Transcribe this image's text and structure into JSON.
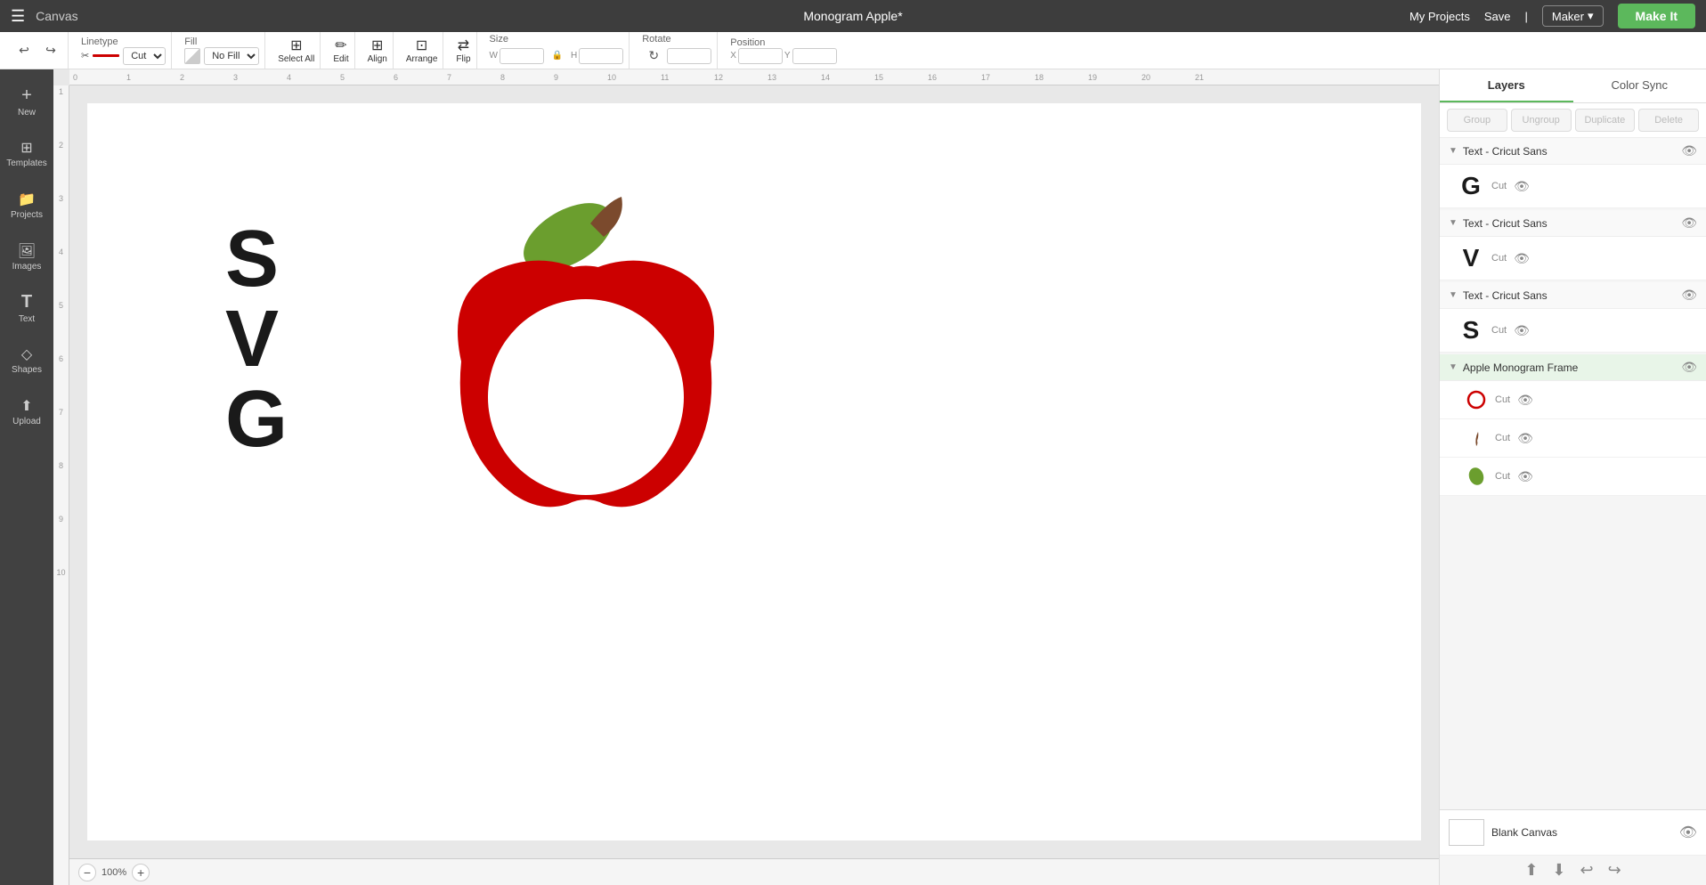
{
  "app": {
    "title": "Canvas",
    "project_title": "Monogram Apple*",
    "nav": {
      "my_projects": "My Projects",
      "save": "Save",
      "maker": "Maker",
      "make_it": "Make It"
    }
  },
  "toolbar": {
    "linetype_label": "Linetype",
    "linetype_value": "Cut",
    "fill_label": "Fill",
    "fill_value": "No Fill",
    "select_all": "Select All",
    "edit": "Edit",
    "align": "Align",
    "arrange": "Arrange",
    "flip": "Flip",
    "size": "Size",
    "rotate": "Rotate",
    "position": "Position",
    "undo_label": "undo",
    "redo_label": "redo"
  },
  "sidebar": {
    "items": [
      {
        "id": "new",
        "label": "New",
        "icon": "+"
      },
      {
        "id": "templates",
        "label": "Templates",
        "icon": "⊞"
      },
      {
        "id": "projects",
        "label": "Projects",
        "icon": "📁"
      },
      {
        "id": "images",
        "label": "Images",
        "icon": "🖼"
      },
      {
        "id": "text",
        "label": "Text",
        "icon": "T"
      },
      {
        "id": "shapes",
        "label": "Shapes",
        "icon": "◇"
      },
      {
        "id": "upload",
        "label": "Upload",
        "icon": "↑"
      }
    ]
  },
  "layers": {
    "tab_layers": "Layers",
    "tab_color_sync": "Color Sync",
    "actions": {
      "group": "Group",
      "ungroup": "Ungroup",
      "duplicate": "Duplicate",
      "delete": "Delete"
    },
    "items": [
      {
        "type": "group",
        "name": "Text - Cricut Sans",
        "children": [
          {
            "letter": "G",
            "sublabel": "Cut",
            "color": "#1a1a1a",
            "is_text": true
          }
        ]
      },
      {
        "type": "group",
        "name": "Text - Cricut Sans",
        "children": [
          {
            "letter": "V",
            "sublabel": "Cut",
            "color": "#1a1a1a",
            "is_text": true
          }
        ]
      },
      {
        "type": "group",
        "name": "Text - Cricut Sans",
        "children": [
          {
            "letter": "S",
            "sublabel": "Cut",
            "color": "#1a1a1a",
            "is_text": true
          }
        ]
      },
      {
        "type": "group",
        "name": "Apple Monogram Frame",
        "selected": true,
        "children": [
          {
            "sublabel": "Cut",
            "color": "#cc0000",
            "shape": "circle_outline"
          },
          {
            "sublabel": "Cut",
            "color": "#7b4a2d",
            "shape": "stem"
          },
          {
            "sublabel": "Cut",
            "color": "#6b9e2e",
            "shape": "leaf"
          }
        ]
      }
    ],
    "footer": {
      "blank_canvas": "Blank Canvas"
    }
  },
  "canvas": {
    "zoom": "100%",
    "letters": "S\nV\nG",
    "zoom_minus": "−",
    "zoom_plus": "+"
  }
}
